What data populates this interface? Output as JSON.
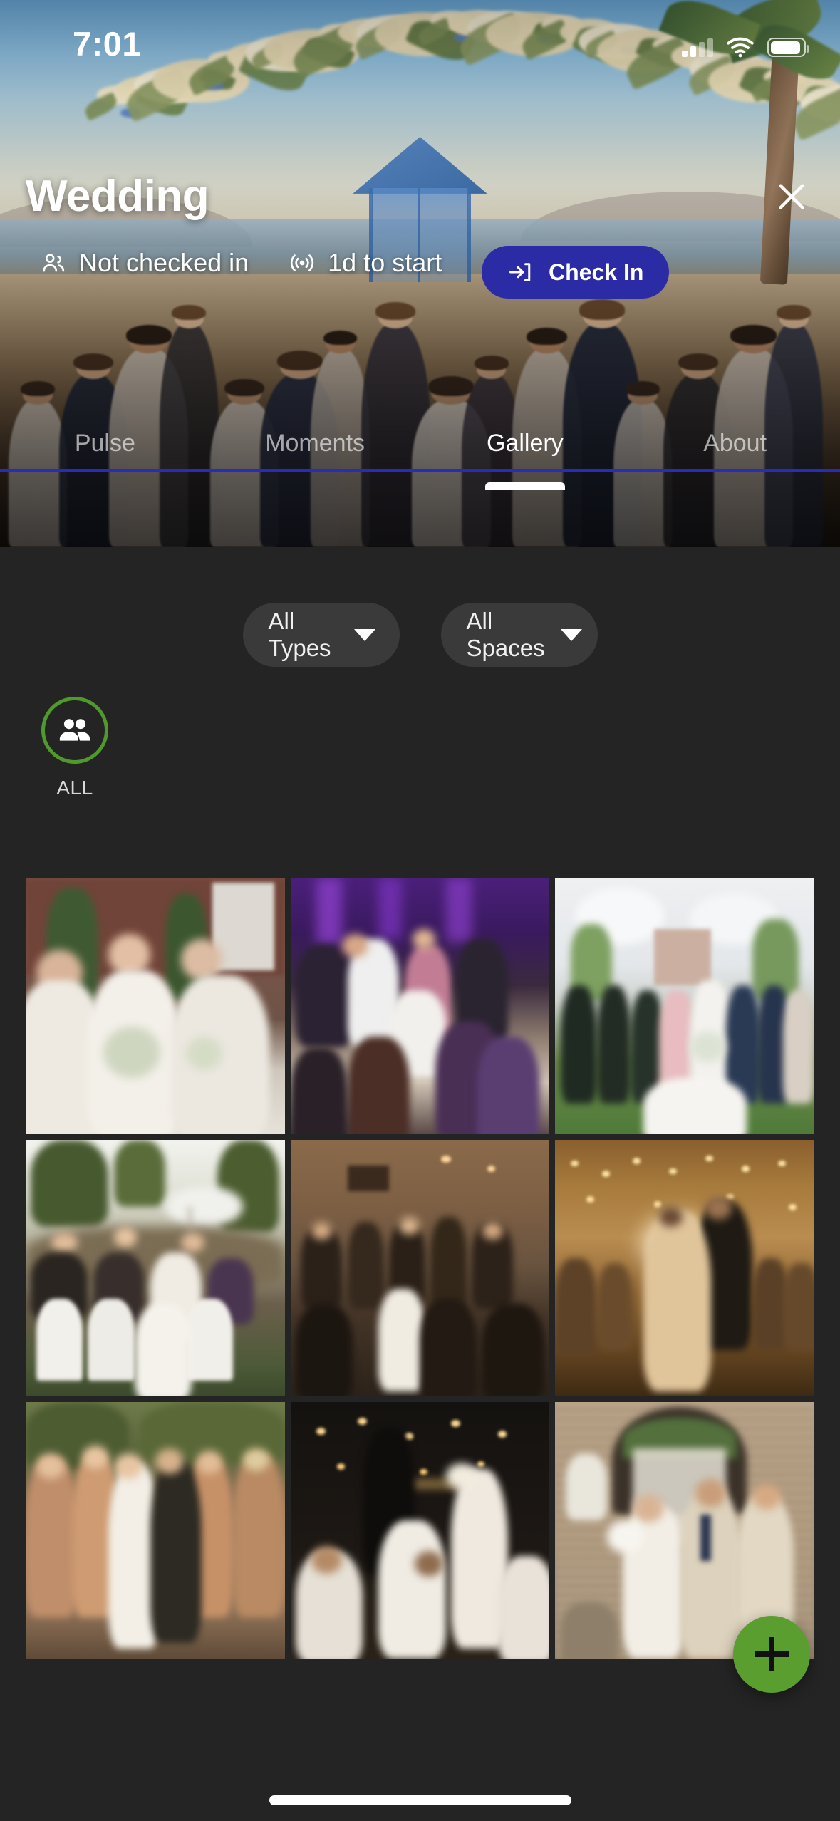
{
  "status_bar": {
    "time": "7:01",
    "cellular_icon": "cellular-signal-icon",
    "cellular_bars_filled": 2,
    "cellular_bars_total": 4,
    "wifi_icon": "wifi-icon",
    "battery_icon": "battery-icon",
    "battery_level_percent": 83
  },
  "hero": {
    "event_title": "Wedding",
    "close_icon": "close-icon",
    "meta": [
      {
        "icon": "people-icon",
        "label": "Not checked in"
      },
      {
        "icon": "broadcast-icon",
        "label": "1d to start"
      }
    ],
    "check_in": {
      "label": "Check In",
      "icon": "login-arrow-icon",
      "color": "#2b2ba6"
    }
  },
  "tabs": {
    "items": [
      {
        "label": "Pulse",
        "active": false
      },
      {
        "label": "Moments",
        "active": false
      },
      {
        "label": "Gallery",
        "active": true
      },
      {
        "label": "About",
        "active": false
      }
    ],
    "rule_color": "#2a2ac0",
    "indicator_color": "#ffffff"
  },
  "filters": [
    {
      "label": "All Types",
      "icon": "chevron-down-icon"
    },
    {
      "label": "All Spaces",
      "icon": "chevron-down-icon"
    }
  ],
  "avatars": [
    {
      "label": "ALL",
      "icon": "people-icon",
      "ring_color": "#4f9a2a",
      "selected": true
    }
  ],
  "gallery": {
    "photos": [
      {
        "alt": "Bride with bridesmaids in white dresses holding bouquets outside brick building"
      },
      {
        "alt": "Guests dancing on reception floor under purple uplighting"
      },
      {
        "alt": "Wedding party group portrait on green lawn under floral arch"
      },
      {
        "alt": "Outdoor reception dinner with white bentwood chairs at sunset"
      },
      {
        "alt": "Packed dance floor inside rustic brick venue"
      },
      {
        "alt": "Bride and groom first dance under string lights in tent"
      },
      {
        "alt": "Couple kissing surrounded by bridesmaids in champagne dresses"
      },
      {
        "alt": "Night dance party under hanging bulb string lights"
      },
      {
        "alt": "Newlyweds exiting stone archway with guests in cream suits"
      }
    ]
  },
  "fab": {
    "icon": "plus-icon",
    "color": "#5a9e2f"
  },
  "home_indicator": {
    "icon": "home-indicator"
  },
  "theme": {
    "background": "#242424",
    "surface": "#3a3a3a",
    "accent_green": "#5a9e2f",
    "accent_blue": "#2b2ba6"
  }
}
